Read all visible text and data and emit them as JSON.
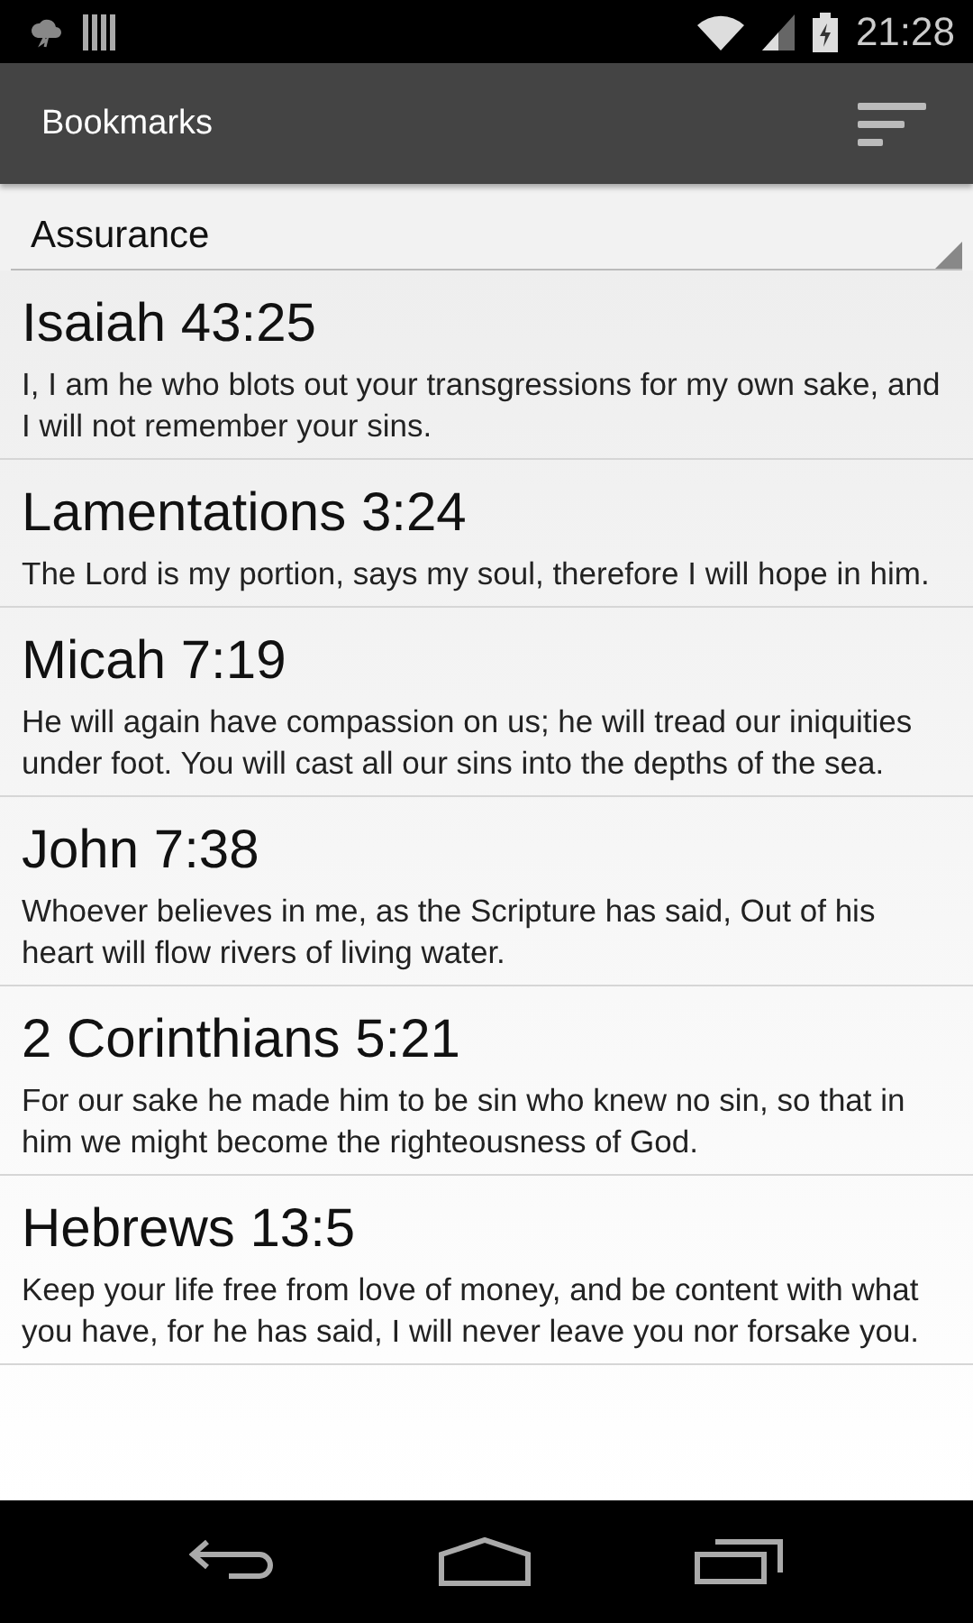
{
  "status_bar": {
    "time": "21:28"
  },
  "action_bar": {
    "title": "Bookmarks"
  },
  "category": {
    "value": "Assurance"
  },
  "bookmarks": [
    {
      "reference": "Isaiah 43:25",
      "text": "I, I am he who blots out your transgressions for my own sake, and I will not remember your sins."
    },
    {
      "reference": "Lamentations 3:24",
      "text": "The Lord is my portion, says my soul, therefore I will hope in him."
    },
    {
      "reference": "Micah 7:19",
      "text": "He will again have compassion on us; he will tread our iniquities under foot. You will cast all our sins into the depths of the sea."
    },
    {
      "reference": "John 7:38",
      "text": "Whoever believes in me, as the Scripture has said, Out of his heart will flow rivers of living water."
    },
    {
      "reference": "2 Corinthians 5:21",
      "text": "For our sake he made him to be sin who knew no sin, so that in him we might become the righteousness of God."
    },
    {
      "reference": "Hebrews 13:5",
      "text": "Keep your life free from love of money, and be content with what you have, for he has said, I will never leave you nor forsake you."
    }
  ]
}
